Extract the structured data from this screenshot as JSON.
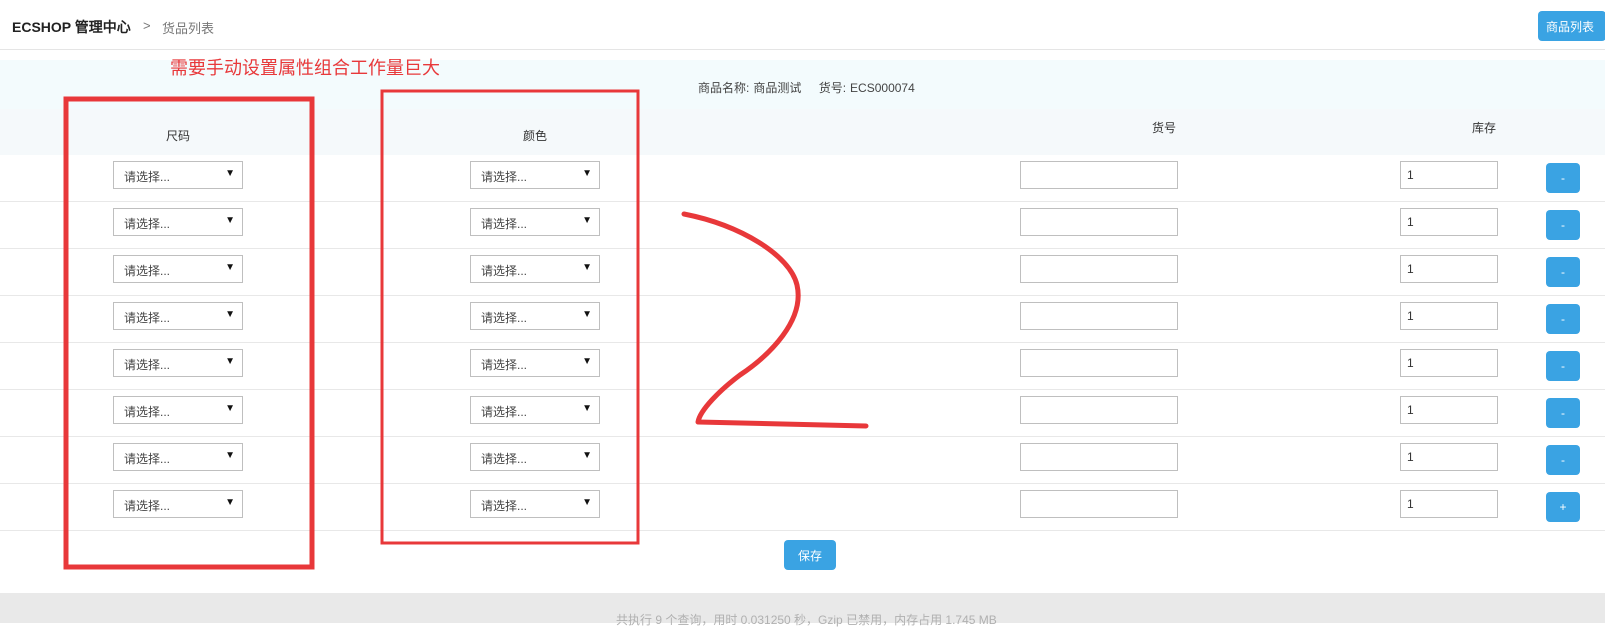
{
  "header": {
    "brand": "ECSHOP 管理中心",
    "separator": ">",
    "breadcrumb": "货品列表",
    "list_button": "商品列表"
  },
  "annotation": {
    "text": "需要手动设置属性组合工作量巨大",
    "number": "2",
    "color": "#e8383a"
  },
  "info": {
    "name_label": "商品名称:",
    "name_value": "商品测试",
    "sn_label": "货号:",
    "sn_value": "ECS000074"
  },
  "columns": {
    "size": "尺码",
    "color": "颜色",
    "sn": "货号",
    "stock": "库存"
  },
  "rows": [
    {
      "size": "请选择...",
      "color": "请选择...",
      "sn": "",
      "stock": "1",
      "action": "-"
    },
    {
      "size": "请选择...",
      "color": "请选择...",
      "sn": "",
      "stock": "1",
      "action": "-"
    },
    {
      "size": "请选择...",
      "color": "请选择...",
      "sn": "",
      "stock": "1",
      "action": "-"
    },
    {
      "size": "请选择...",
      "color": "请选择...",
      "sn": "",
      "stock": "1",
      "action": "-"
    },
    {
      "size": "请选择...",
      "color": "请选择...",
      "sn": "",
      "stock": "1",
      "action": "-"
    },
    {
      "size": "请选择...",
      "color": "请选择...",
      "sn": "",
      "stock": "1",
      "action": "-"
    },
    {
      "size": "请选择...",
      "color": "请选择...",
      "sn": "",
      "stock": "1",
      "action": "-"
    },
    {
      "size": "请选择...",
      "color": "请选择...",
      "sn": "",
      "stock": "1",
      "action": "+"
    }
  ],
  "save_label": "保存",
  "footer": "共执行 9 个查询，用时 0.031250 秒，Gzip 已禁用，内存占用 1.745 MB",
  "colors": {
    "accent": "#3aa3e3",
    "annotation": "#e8383a"
  }
}
